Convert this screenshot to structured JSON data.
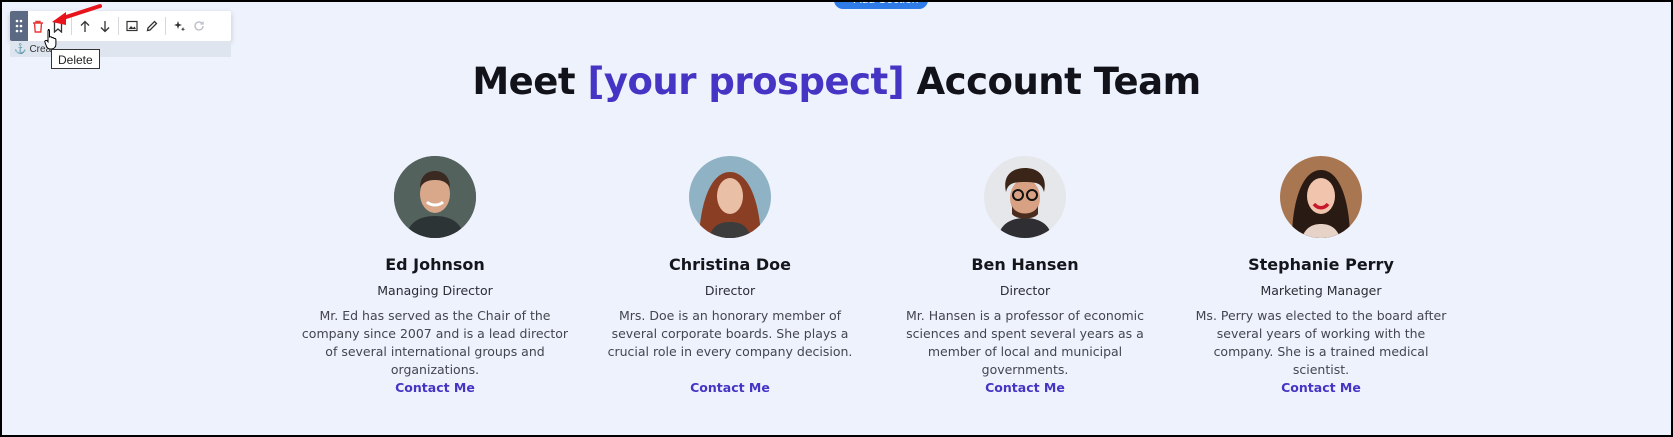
{
  "add_section_label": "+ Add Section",
  "toolbar": {
    "sub_label": "Crea",
    "tooltip": "Delete"
  },
  "heading": {
    "prefix": "Meet ",
    "highlight": "[your prospect]",
    "suffix": " Account Team"
  },
  "colors": {
    "accent": "#4535c4",
    "background": "#eef2fd",
    "delete_red": "#e53935"
  },
  "members": [
    {
      "name": "Ed Johnson",
      "role": "Managing Director",
      "bio": "Mr. Ed has served as the Chair of the company since 2007 and is a lead director of several international groups and organizations.",
      "contact": "Contact Me"
    },
    {
      "name": "Christina Doe",
      "role": "Director",
      "bio": "Mrs. Doe is an honorary member of several corporate boards. She plays a crucial role in every company decision.",
      "contact": "Contact Me"
    },
    {
      "name": "Ben Hansen",
      "role": "Director",
      "bio": "Mr. Hansen is a professor of economic sciences and spent several years as a member of local and municipal governments.",
      "contact": "Contact Me"
    },
    {
      "name": "Stephanie Perry",
      "role": "Marketing Manager",
      "bio": "Ms. Perry was elected to the board after several years of working with the company. She is a trained medical scientist.",
      "contact": "Contact Me"
    }
  ]
}
